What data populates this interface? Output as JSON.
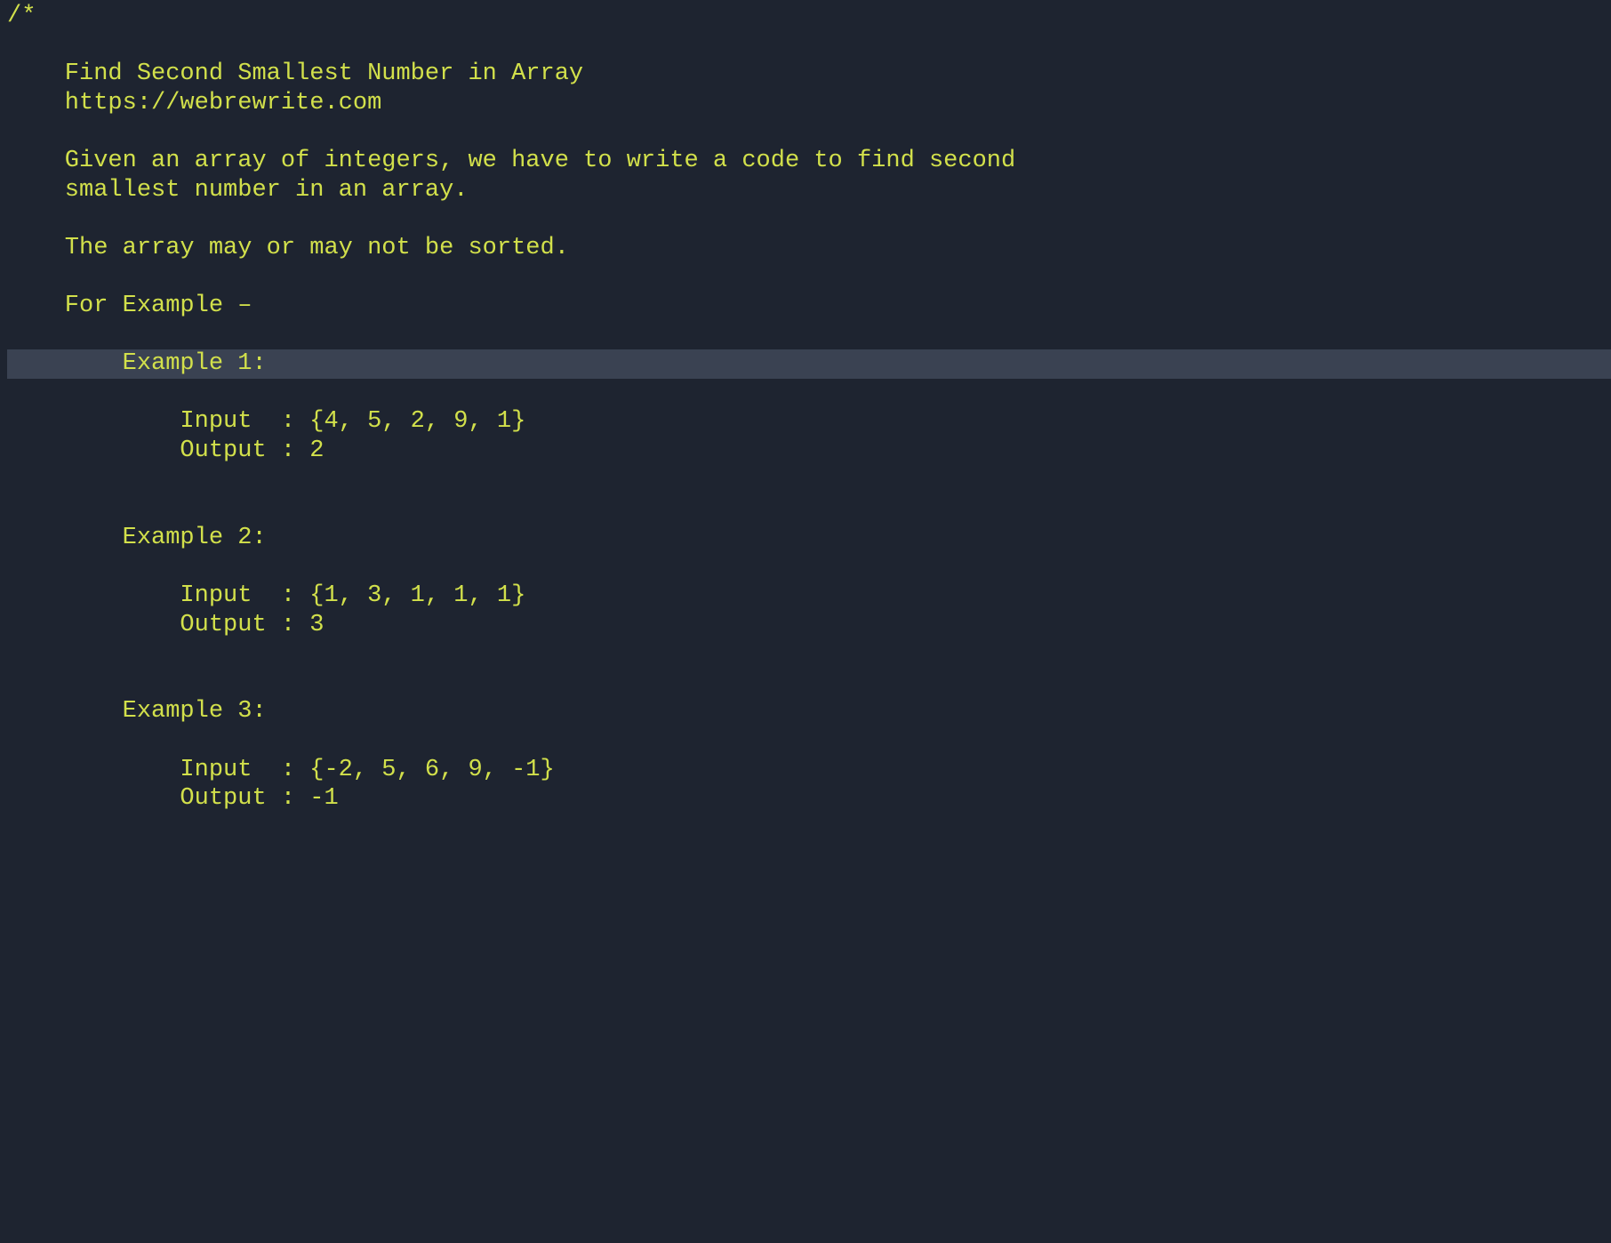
{
  "colors": {
    "background": "#1e2430",
    "comment": "#d2e04b",
    "highlight": "#3a4252",
    "gutter": "#4a5263"
  },
  "highlighted_line_index": 12,
  "code_lines": [
    "/*",
    "",
    "    Find Second Smallest Number in Array",
    "    https://webrewrite.com",
    "",
    "    Given an array of integers, we have to write a code to find second",
    "    smallest number in an array.",
    "",
    "    The array may or may not be sorted.",
    "",
    "    For Example –",
    "",
    "        Example 1:",
    "",
    "            Input  : {4, 5, 2, 9, 1}",
    "            Output : 2",
    "",
    "",
    "        Example 2:",
    "",
    "            Input  : {1, 3, 1, 1, 1}",
    "            Output : 3",
    "",
    "",
    "        Example 3:",
    "",
    "            Input  : {-2, 5, 6, 9, -1}",
    "            Output : -1"
  ]
}
